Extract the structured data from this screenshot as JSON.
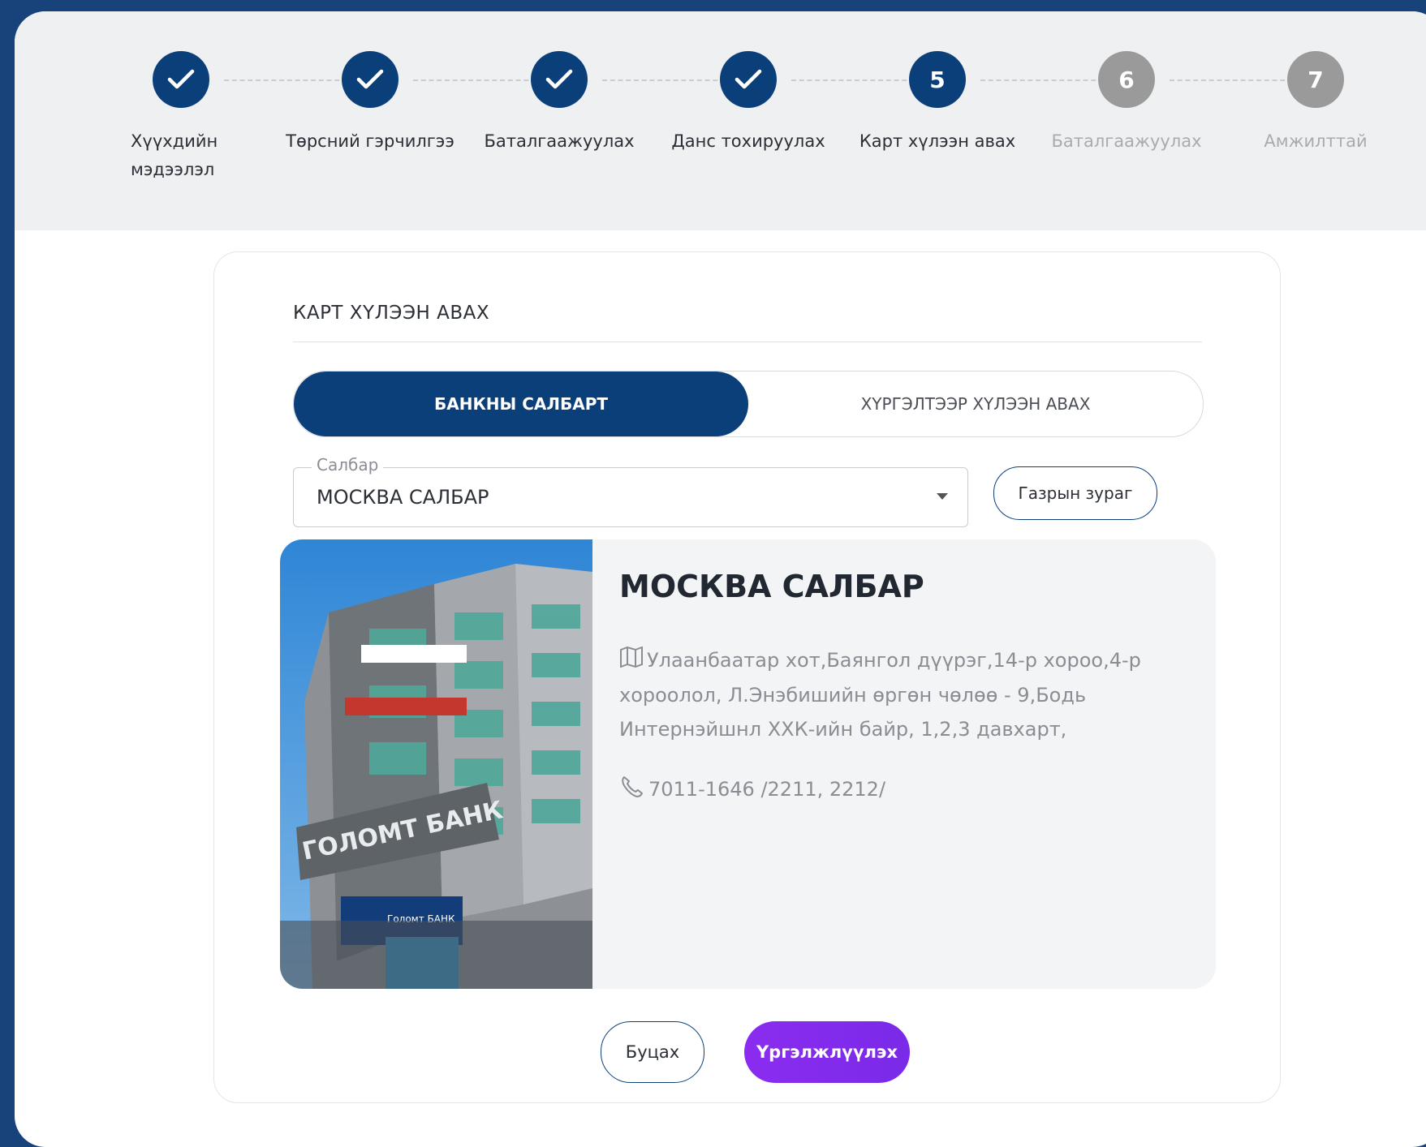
{
  "stepper": {
    "steps": [
      {
        "label": "Хүүхдийн\nмэдээлэл",
        "marker": "",
        "state": "done"
      },
      {
        "label": "Төрсний гэрчилгээ",
        "marker": "",
        "state": "done"
      },
      {
        "label": "Баталгаажуулах",
        "marker": "",
        "state": "done"
      },
      {
        "label": "Данс тохируулах",
        "marker": "",
        "state": "done"
      },
      {
        "label": "Карт хүлээн авах",
        "marker": "5",
        "state": "active"
      },
      {
        "label": "Баталгаажуулах",
        "marker": "6",
        "state": "pending"
      },
      {
        "label": "Амжилттай",
        "marker": "7",
        "state": "pending"
      }
    ]
  },
  "form": {
    "title": "КАРТ ХҮЛЭЭН АВАХ",
    "toggle": {
      "active_label": "БАНКНЫ САЛБАРТ",
      "inactive_label": "ХҮРГЭЛТЭЭР ХҮЛЭЭН АВАХ"
    },
    "branch_select": {
      "label": "Салбар",
      "value": "МОСКВА САЛБАР"
    },
    "map_button_label": "Газрын зураг"
  },
  "branch": {
    "name": "МОСКВА САЛБАР",
    "address": "Улаанбаатар хот,Баянгол дүүрэг,14-р хороо,4-р хороолол, Л.Энэбишийн өргөн чөлөө - 9,Бодь Интернэйшнл ХХК-ийн байр, 1,2,3 давхарт,",
    "phone": "7011-1646 /2211, 2212/",
    "photo_signs": {
      "main": "ГОЛОМТ БАНК",
      "door": "Голомт БАНК"
    }
  },
  "actions": {
    "back_label": "Буцах",
    "continue_label": "Үргэлжлүүлэх"
  },
  "colors": {
    "primary": "#0b3f7a",
    "accent": "#8b2cf0",
    "pending": "#9a9a9a",
    "frame": "#17427a"
  }
}
